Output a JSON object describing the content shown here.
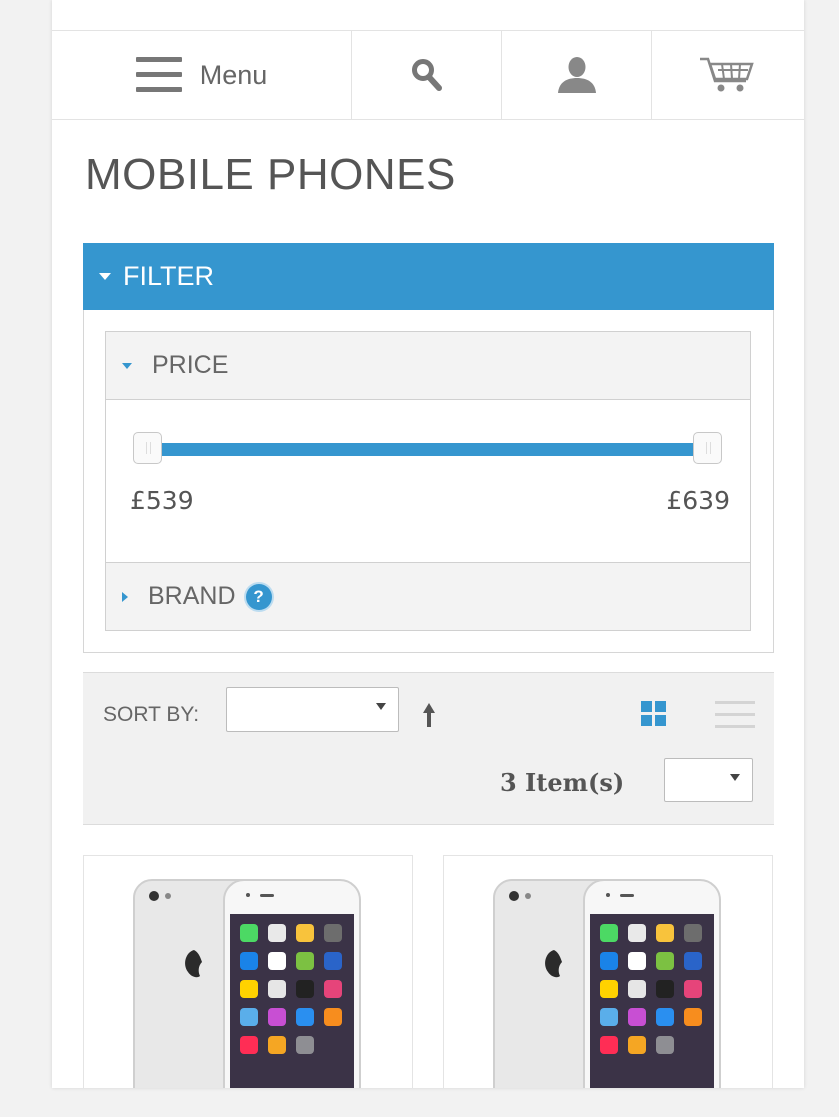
{
  "header": {
    "menu_label": "Menu",
    "icons": [
      "hamburger-icon",
      "search-icon",
      "user-icon",
      "cart-icon"
    ]
  },
  "page_title": "MOBILE PHONES",
  "filter": {
    "title": "FILTER",
    "facets": {
      "price": {
        "label": "PRICE",
        "min_label": "£539",
        "max_label": "£639",
        "range_selected_fraction": [
          0,
          1
        ]
      },
      "brand": {
        "label": "BRAND",
        "help_icon": "question-circle-icon"
      }
    }
  },
  "toolbar": {
    "sort_label": "SORT BY:",
    "sort_value": "",
    "item_count": "3 Item(s)",
    "limit_value": ""
  },
  "products": [
    {
      "image": "iphone-6-silver"
    },
    {
      "image": "iphone-6-silver"
    }
  ],
  "colors": {
    "accent": "#3596cf",
    "title_text": "#555555",
    "toolbar_bg": "#f1f1f1"
  }
}
